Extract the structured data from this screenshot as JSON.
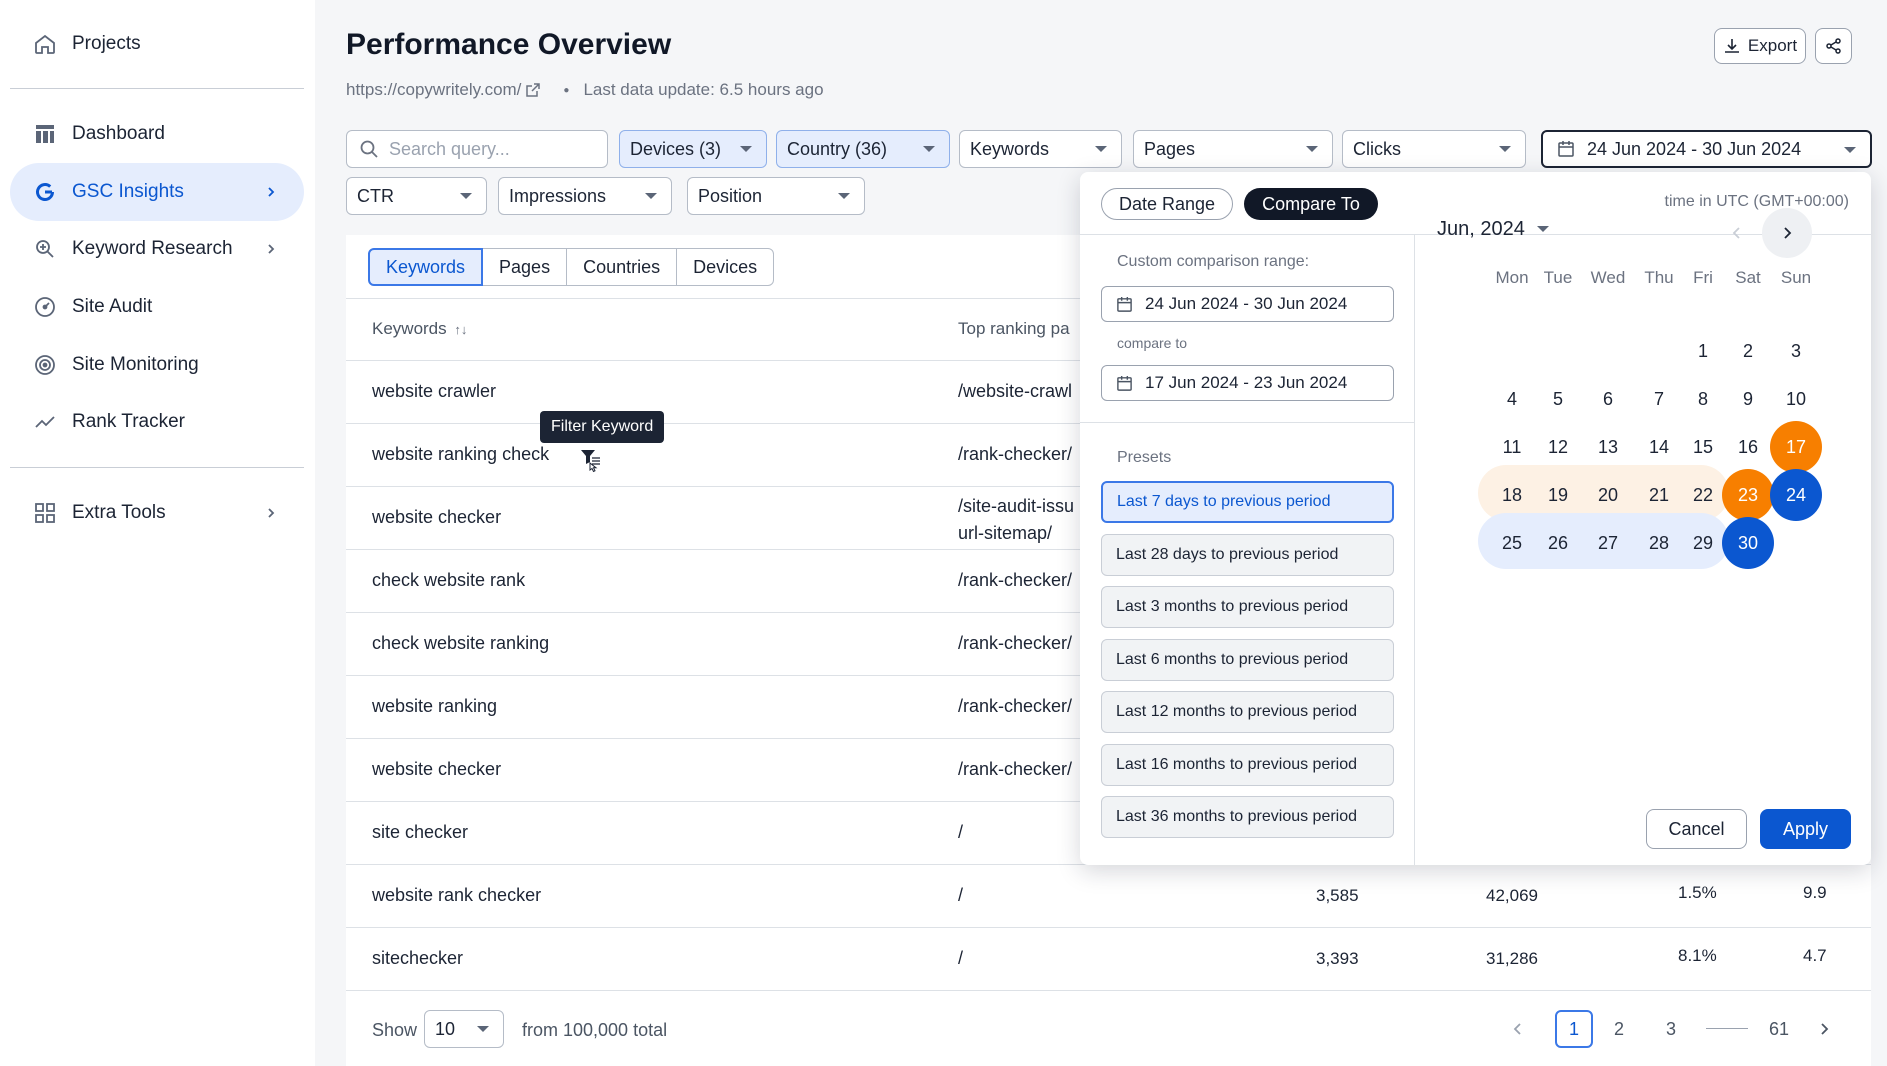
{
  "sidebar": {
    "projects": "Projects",
    "items": [
      {
        "label": "Dashboard"
      },
      {
        "label": "GSC Insights"
      },
      {
        "label": "Keyword Research"
      },
      {
        "label": "Site Audit"
      },
      {
        "label": "Site Monitoring"
      },
      {
        "label": "Rank Tracker"
      }
    ],
    "extra_tools": "Extra Tools",
    "active_item": "GSC Insights"
  },
  "header": {
    "title": "Performance Overview",
    "site_url": "https://copywritely.com/",
    "last_update": "Last data update: 6.5 hours ago",
    "export_label": "Export"
  },
  "filters": {
    "search_placeholder": "Search query...",
    "devices": "Devices (3)",
    "country": "Country (36)",
    "keywords": "Keywords",
    "pages": "Pages",
    "clicks": "Clicks",
    "date_range": "24 Jun 2024 - 30 Jun 2024",
    "ctr": "CTR",
    "impressions": "Impressions",
    "position": "Position"
  },
  "table": {
    "tabs": [
      "Keywords",
      "Pages",
      "Countries",
      "Devices"
    ],
    "active_tab": "Keywords",
    "col_keywords": "Keywords",
    "col_top_page": "Top ranking pa",
    "sort_icon": "sort-icon",
    "rows": [
      {
        "keyword": "website crawler",
        "page": "/website-crawl"
      },
      {
        "keyword": "website ranking check",
        "page": "/rank-checker/"
      },
      {
        "keyword": "website checker",
        "page": "/site-audit-issu",
        "page2": "url-sitemap/"
      },
      {
        "keyword": "check website rank",
        "page": "/rank-checker/"
      },
      {
        "keyword": "check website ranking",
        "page": "/rank-checker/"
      },
      {
        "keyword": "website ranking",
        "page": "/rank-checker/"
      },
      {
        "keyword": "website checker",
        "page": "/rank-checker/"
      },
      {
        "keyword": "site checker",
        "page": "/"
      },
      {
        "keyword": "website rank checker",
        "page": "/",
        "clicks": "3,585",
        "impressions": "42,069",
        "ctr": "1.5%",
        "position": "9.9"
      },
      {
        "keyword": "sitechecker",
        "page": "/",
        "clicks": "3,393",
        "impressions": "31,286",
        "ctr": "8.1%",
        "position": "4.7"
      }
    ],
    "tooltip": "Filter Keyword"
  },
  "footer": {
    "show_label": "Show",
    "page_size": "10",
    "total": "from 100,000 total",
    "pages": [
      "1",
      "2",
      "3",
      "61"
    ],
    "current_page": "1"
  },
  "datepicker": {
    "tab_date_range": "Date Range",
    "tab_compare": "Compare To",
    "active_tab": "Compare To",
    "timezone": "time in UTC (GMT+00:00)",
    "custom_label": "Custom comparison range:",
    "range_value": "24 Jun 2024 - 30 Jun 2024",
    "compare_label": "compare to",
    "compare_value": "17 Jun 2024 - 23 Jun 2024",
    "presets_label": "Presets",
    "presets": [
      "Last 7 days to previous period",
      "Last 28 days to previous period",
      "Last 3 months to previous period",
      "Last 6 months to previous period",
      "Last 12 months to previous period",
      "Last 16 months to previous period",
      "Last 36 months to previous period"
    ],
    "selected_preset": "Last 7 days to previous period",
    "month": "Jun, 2024",
    "weekdays": [
      "Mon",
      "Tue",
      "Wed",
      "Thu",
      "Fri",
      "Sat",
      "Sun"
    ],
    "weeks": [
      [
        "",
        "",
        "",
        "",
        "1",
        "2",
        "3"
      ],
      [
        "4",
        "5",
        "6",
        "7",
        "8",
        "9",
        "10"
      ],
      [
        "11",
        "12",
        "13",
        "14",
        "15",
        "16",
        "17"
      ],
      [
        "18",
        "19",
        "20",
        "21",
        "22",
        "23",
        "24"
      ],
      [
        "25",
        "26",
        "27",
        "28",
        "29",
        "30",
        ""
      ]
    ],
    "compare_range": {
      "start": "17",
      "end": "23",
      "color": "#f77f00"
    },
    "selected_range": {
      "start": "24",
      "end": "30",
      "color": "#0b57d0"
    },
    "cancel": "Cancel",
    "apply": "Apply"
  },
  "colors": {
    "accent": "#0b57d0",
    "compare": "#f77f00",
    "selected_bg": "#e5edfd"
  }
}
